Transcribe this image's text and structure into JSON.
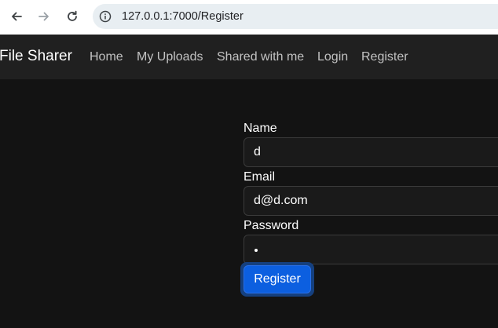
{
  "browser": {
    "url": "127.0.0.1:7000/Register",
    "icons": [
      "back-arrow-icon",
      "forward-arrow-icon",
      "reload-icon",
      "site-info-icon"
    ]
  },
  "navbar": {
    "brand": "File Sharer",
    "links": [
      "Home",
      "My Uploads",
      "Shared with me",
      "Login",
      "Register"
    ]
  },
  "form": {
    "name_label": "Name",
    "name_value": "d",
    "email_label": "Email",
    "email_value": "d@d.com",
    "password_label": "Password",
    "password_value": "•",
    "submit_label": "Register"
  },
  "colors": {
    "page_background": "#131313",
    "navbar_background": "#202020",
    "button_primary": "#0c5fe0",
    "button_focus_ring": "#15407f"
  }
}
